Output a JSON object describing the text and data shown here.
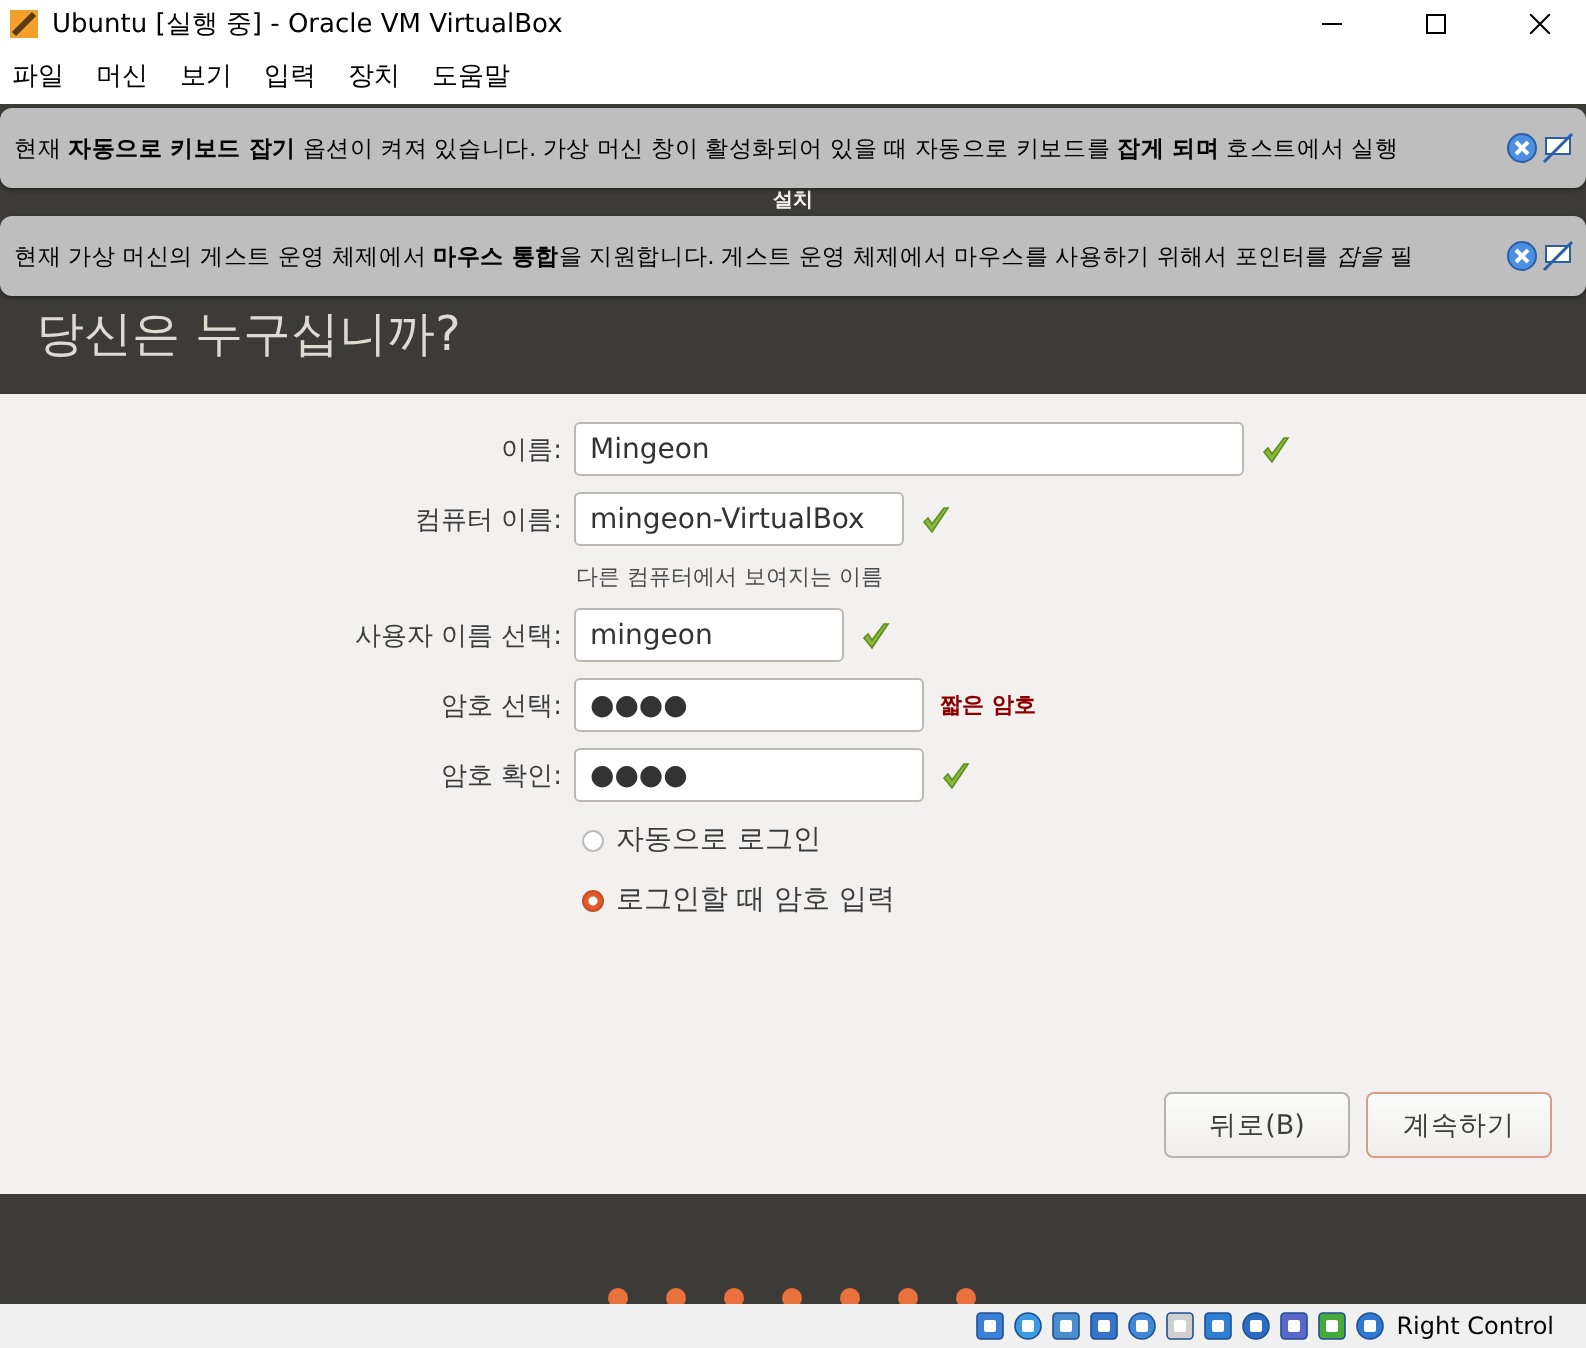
{
  "window": {
    "title": "Ubuntu [실행 중] - Oracle VM VirtualBox"
  },
  "menu": [
    "파일",
    "머신",
    "보기",
    "입력",
    "장치",
    "도움말"
  ],
  "notifications": [
    {
      "text": "현재 **자동으로 키보드 잡기** 옵션이 켜져 있습니다. 가상 머신 창이 활성화되어 있을 때 자동으로 키보드를 **잡게 되며** 호스트에서 실행"
    },
    {
      "text": "현재 가상 머신의 게스트 운영 체제에서 **마우스 통합**을 지원합니다. 게스트 운영 체제에서 마우스를 사용하기 위해서 포인터를 *잡을* 필"
    }
  ],
  "installer": {
    "title": "설치",
    "heading": "당신은 누구십니까?",
    "fields": [
      {
        "label": "이름:",
        "value": "Mingeon",
        "valid": true
      },
      {
        "label": "컴퓨터 이름:",
        "value": "mingeon-VirtualBox",
        "valid": true,
        "hint": "다른 컴퓨터에서 보여지는 이름"
      },
      {
        "label": "사용자 이름 선택:",
        "value": "mingeon",
        "valid": true
      },
      {
        "label": "암호 선택:",
        "value": "●●●●",
        "valid": false,
        "error": "짧은 암호"
      },
      {
        "label": "암호 확인:",
        "value": "●●●●",
        "valid": true
      }
    ],
    "login_options": [
      {
        "label": "자동으로 로그인",
        "selected": false
      },
      {
        "label": "로그인할 때 암호 입력",
        "selected": true
      }
    ],
    "buttons": [
      {
        "label": "뒤로(B)",
        "kind": "secondary"
      },
      {
        "label": "계속하기",
        "kind": "primary"
      }
    ]
  },
  "status_bar": {
    "host_key": "Right Control"
  }
}
